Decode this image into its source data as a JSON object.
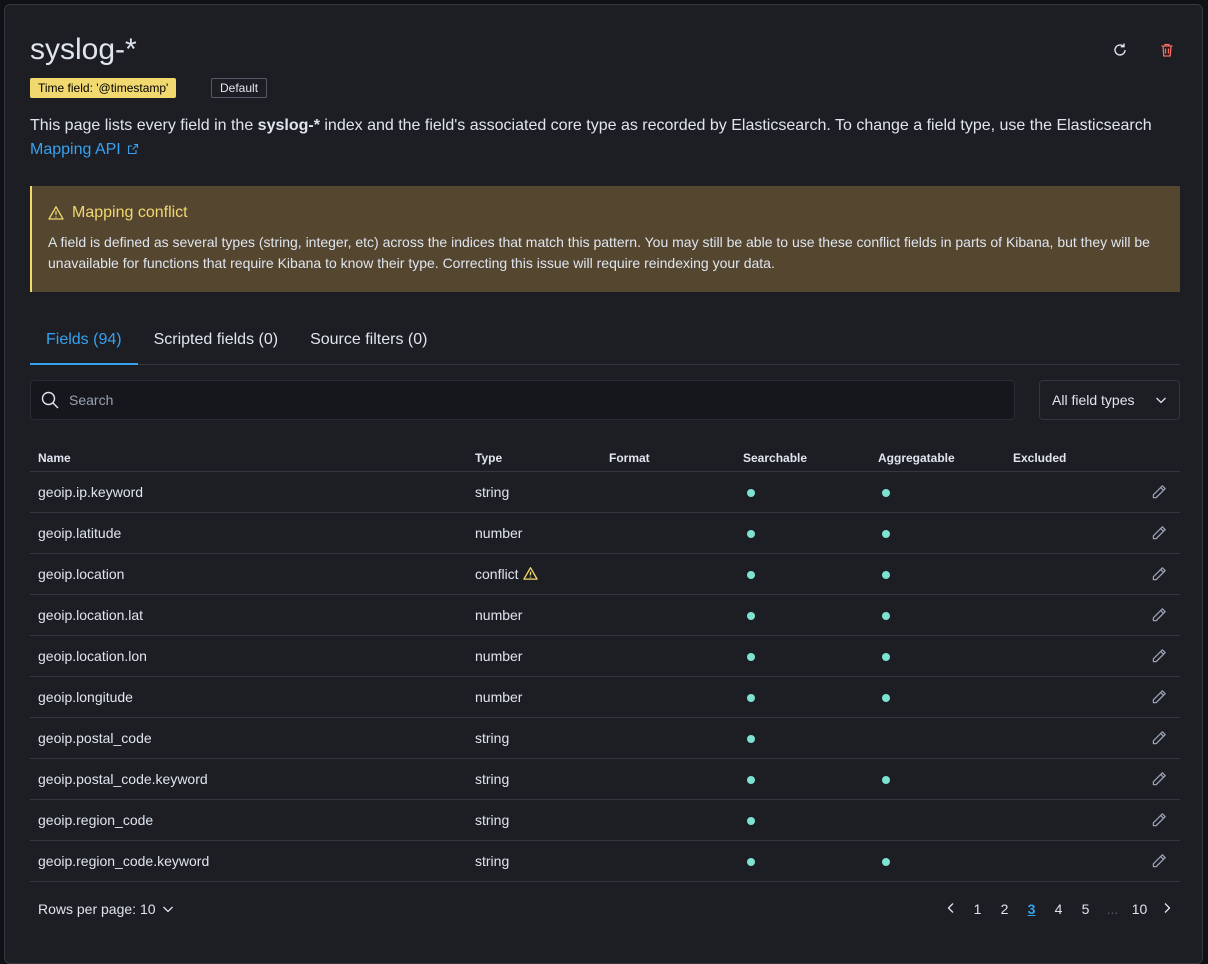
{
  "header": {
    "title": "syslog-*",
    "time_badge": "Time field: '@timestamp'",
    "default_badge": "Default"
  },
  "description": {
    "part1": "This page lists every field in the ",
    "index_name": "syslog-*",
    "part2": " index and the field's associated core type as recorded by Elasticsearch. To change a field type, use the Elasticsearch ",
    "link": "Mapping API"
  },
  "callout": {
    "title": "Mapping conflict",
    "text": "A field is defined as several types (string, integer, etc) across the indices that match this pattern. You may still be able to use these conflict fields in parts of Kibana, but they will be unavailable for functions that require Kibana to know their type. Correcting this issue will require reindexing your data."
  },
  "tabs": [
    {
      "label": "Fields (94)",
      "active": true
    },
    {
      "label": "Scripted fields (0)",
      "active": false
    },
    {
      "label": "Source filters (0)",
      "active": false
    }
  ],
  "search": {
    "placeholder": "Search"
  },
  "type_filter": {
    "label": "All field types"
  },
  "table": {
    "columns": [
      "Name",
      "Type",
      "Format",
      "Searchable",
      "Aggregatable",
      "Excluded"
    ],
    "rows": [
      {
        "name": "geoip.ip.keyword",
        "type": "string",
        "searchable": true,
        "aggregatable": true
      },
      {
        "name": "geoip.latitude",
        "type": "number",
        "searchable": true,
        "aggregatable": true
      },
      {
        "name": "geoip.location",
        "type": "conflict",
        "conflict": true,
        "searchable": true,
        "aggregatable": true
      },
      {
        "name": "geoip.location.lat",
        "type": "number",
        "searchable": true,
        "aggregatable": true
      },
      {
        "name": "geoip.location.lon",
        "type": "number",
        "searchable": true,
        "aggregatable": true
      },
      {
        "name": "geoip.longitude",
        "type": "number",
        "searchable": true,
        "aggregatable": true
      },
      {
        "name": "geoip.postal_code",
        "type": "string",
        "searchable": true,
        "aggregatable": false
      },
      {
        "name": "geoip.postal_code.keyword",
        "type": "string",
        "searchable": true,
        "aggregatable": true
      },
      {
        "name": "geoip.region_code",
        "type": "string",
        "searchable": true,
        "aggregatable": false
      },
      {
        "name": "geoip.region_code.keyword",
        "type": "string",
        "searchable": true,
        "aggregatable": true
      }
    ]
  },
  "pagination": {
    "rows_per_page": "Rows per page: 10",
    "pages": [
      "1",
      "2",
      "3",
      "4",
      "5",
      "...",
      "10"
    ],
    "active": "3"
  },
  "colors": {
    "accent": "#36a2ef",
    "warning": "#f1d86f",
    "dot": "#7de2d1",
    "danger": "#f86b63"
  }
}
